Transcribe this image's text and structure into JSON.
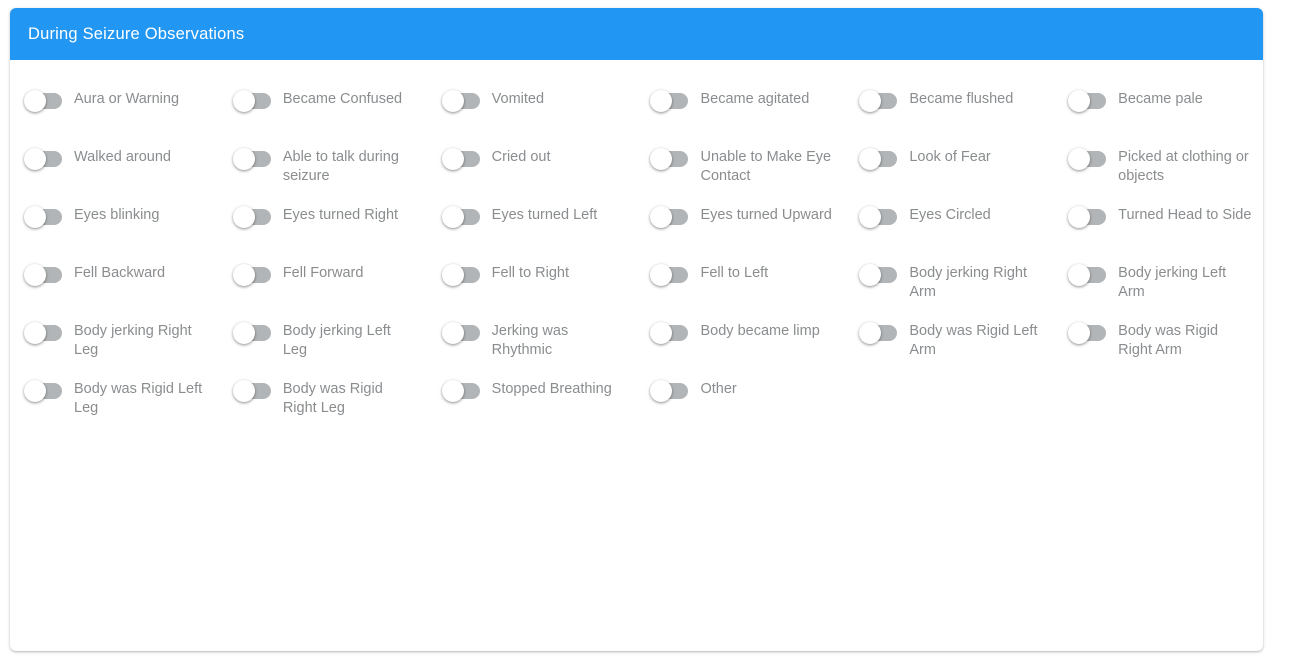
{
  "card": {
    "header": {
      "title": "During Seizure Observations",
      "background_color": "#2196f3",
      "text_color": "#ffffff"
    },
    "accent_color": "#2196f3",
    "toggle_track_color": "#b2b5b7",
    "toggle_knob_color": "#ffffff",
    "label_color": "#8a8d8f"
  },
  "observations": {
    "columns": 6,
    "all_toggles_state": "off",
    "rows": [
      [
        {
          "label": "Aura or Warning",
          "state": "off"
        },
        {
          "label": "Became Confused",
          "state": "off"
        },
        {
          "label": "Vomited",
          "state": "off"
        },
        {
          "label": "Became agitated",
          "state": "off"
        },
        {
          "label": "Became flushed",
          "state": "off"
        },
        {
          "label": "Became pale",
          "state": "off"
        }
      ],
      [
        {
          "label": "Walked around",
          "state": "off"
        },
        {
          "label": "Able to talk during seizure",
          "state": "off"
        },
        {
          "label": "Cried out",
          "state": "off"
        },
        {
          "label": "Unable to Make Eye Contact",
          "state": "off"
        },
        {
          "label": "Look of Fear",
          "state": "off"
        },
        {
          "label": "Picked at clothing or objects",
          "state": "off"
        }
      ],
      [
        {
          "label": "Eyes blinking",
          "state": "off"
        },
        {
          "label": "Eyes turned Right",
          "state": "off"
        },
        {
          "label": "Eyes turned Left",
          "state": "off"
        },
        {
          "label": "Eyes turned Upward",
          "state": "off"
        },
        {
          "label": "Eyes Circled",
          "state": "off"
        },
        {
          "label": "Turned Head to Side",
          "state": "off"
        }
      ],
      [
        {
          "label": "Fell Backward",
          "state": "off"
        },
        {
          "label": "Fell Forward",
          "state": "off"
        },
        {
          "label": "Fell to Right",
          "state": "off"
        },
        {
          "label": "Fell to Left",
          "state": "off"
        },
        {
          "label": "Body jerking Right Arm",
          "state": "off"
        },
        {
          "label": "Body jerking Left Arm",
          "state": "off"
        }
      ],
      [
        {
          "label": "Body jerking Right Leg",
          "state": "off"
        },
        {
          "label": "Body jerking Left Leg",
          "state": "off"
        },
        {
          "label": "Jerking was Rhythmic",
          "state": "off"
        },
        {
          "label": "Body became limp",
          "state": "off"
        },
        {
          "label": "Body was Rigid Left Arm",
          "state": "off"
        },
        {
          "label": "Body was Rigid Right Arm",
          "state": "off"
        }
      ],
      [
        {
          "label": "Body was Rigid Left Leg",
          "state": "off"
        },
        {
          "label": "Body was Rigid Right Leg",
          "state": "off"
        },
        {
          "label": "Stopped Breathing",
          "state": "off"
        },
        {
          "label": "Other",
          "state": "off"
        },
        {
          "label": "",
          "state": "empty"
        },
        {
          "label": "",
          "state": "empty"
        }
      ]
    ]
  }
}
